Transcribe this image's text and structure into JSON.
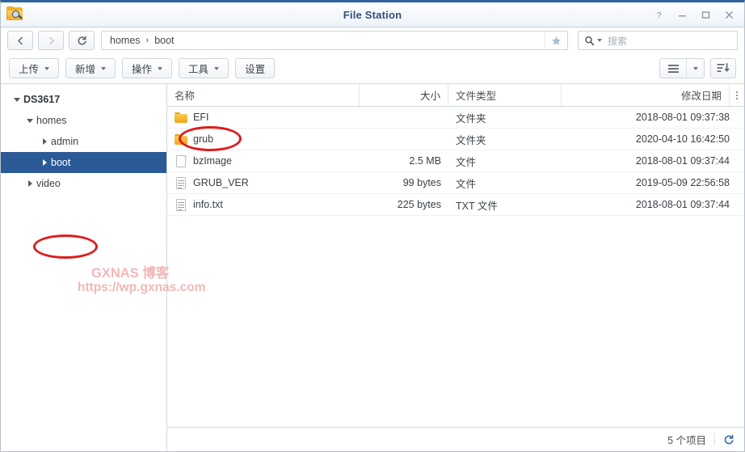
{
  "window": {
    "title": "File Station",
    "app_icon": "folder-search-icon",
    "controls": {
      "help": "help-icon",
      "minimize": "minimize-icon",
      "maximize": "maximize-icon",
      "close": "close-icon"
    }
  },
  "nav": {
    "back": "back-icon",
    "forward": "forward-icon",
    "refresh": "refresh-icon",
    "breadcrumb": [
      "homes",
      "boot"
    ],
    "separator": "›",
    "favorite": "star-icon",
    "search": {
      "icon": "search-icon",
      "placeholder": "搜索",
      "value": ""
    }
  },
  "toolbar": {
    "buttons": [
      {
        "label": "上传",
        "caret": true
      },
      {
        "label": "新增",
        "caret": true
      },
      {
        "label": "操作",
        "caret": true
      },
      {
        "label": "工具",
        "caret": true
      },
      {
        "label": "设置",
        "caret": false
      }
    ],
    "view_icon": "list-view-icon",
    "view_caret": "chevron-down-icon",
    "sort_icon": "sort-descending-icon"
  },
  "sidebar": {
    "items": [
      {
        "label": "DS3617",
        "level": 0,
        "expanded": true,
        "selected": false
      },
      {
        "label": "homes",
        "level": 1,
        "expanded": true,
        "selected": false
      },
      {
        "label": "admin",
        "level": 2,
        "expanded": false,
        "selected": false
      },
      {
        "label": "boot",
        "level": 2,
        "expanded": false,
        "selected": true
      },
      {
        "label": "video",
        "level": 1,
        "expanded": false,
        "selected": false
      }
    ]
  },
  "filelist": {
    "columns": {
      "name": "名称",
      "size": "大小",
      "type": "文件类型",
      "date": "修改日期",
      "menu": "column-options-icon"
    },
    "rows": [
      {
        "name": "EFI",
        "size": "",
        "type": "文件夹",
        "date": "2018-08-01 09:37:38",
        "icon": "folder"
      },
      {
        "name": "grub",
        "size": "",
        "type": "文件夹",
        "date": "2020-04-10 16:42:50",
        "icon": "folder"
      },
      {
        "name": "bzImage",
        "size": "2.5 MB",
        "type": "文件",
        "date": "2018-08-01 09:37:44",
        "icon": "file"
      },
      {
        "name": "GRUB_VER",
        "size": "99 bytes",
        "type": "文件",
        "date": "2019-05-09 22:56:58",
        "icon": "doc"
      },
      {
        "name": "info.txt",
        "size": "225 bytes",
        "type": "TXT 文件",
        "date": "2018-08-01 09:37:44",
        "icon": "doc"
      }
    ]
  },
  "statusbar": {
    "count_label": "5 个项目",
    "refresh_icon": "refresh-icon"
  },
  "watermark": {
    "line1": "GXNAS 博客",
    "line2": "https://wp.gxnas.com"
  },
  "annotations": {
    "boot_highlight": "red-ellipse-boot",
    "grub_highlight": "red-ellipse-grub"
  },
  "colors": {
    "title_blue": "#2e4e7e",
    "selection_blue": "#2b5a97",
    "folder_orange": "#efa51d",
    "annotation_red": "#e01b1b",
    "watermark_pink": "#f2b7b7"
  }
}
